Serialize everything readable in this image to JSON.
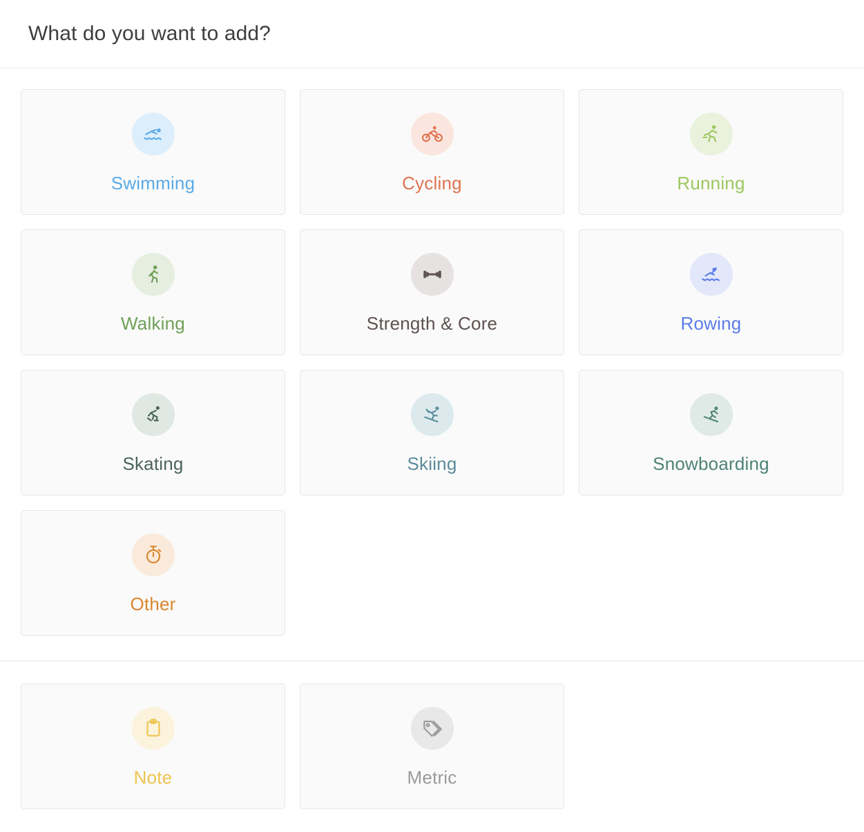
{
  "header": {
    "title": "What do you want to add?"
  },
  "activities": {
    "section_name": "activity-types",
    "items": [
      {
        "id": "swimming",
        "label": "Swimming",
        "icon": "swimmer-icon",
        "color": "#5aaae6",
        "circle_bg": "#dceefb"
      },
      {
        "id": "cycling",
        "label": "Cycling",
        "icon": "cyclist-icon",
        "color": "#df7350",
        "circle_bg": "#fae6de"
      },
      {
        "id": "running",
        "label": "Running",
        "icon": "runner-icon",
        "color": "#9cc75f",
        "circle_bg": "#eaf2dd"
      },
      {
        "id": "walking",
        "label": "Walking",
        "icon": "walker-icon",
        "color": "#6f9f59",
        "circle_bg": "#e6eedf"
      },
      {
        "id": "strength",
        "label": "Strength & Core",
        "icon": "dumbbell-icon",
        "color": "#5d5250",
        "circle_bg": "#e6e2e1"
      },
      {
        "id": "rowing",
        "label": "Rowing",
        "icon": "rower-icon",
        "color": "#5b7ce8",
        "circle_bg": "#e2e7fa"
      },
      {
        "id": "skating",
        "label": "Skating",
        "icon": "skater-icon",
        "color": "#4b6359",
        "circle_bg": "#dfe8e3"
      },
      {
        "id": "skiing",
        "label": "Skiing",
        "icon": "skier-icon",
        "color": "#5b8b9b",
        "circle_bg": "#dceaee"
      },
      {
        "id": "snowboarding",
        "label": "Snowboarding",
        "icon": "snowboarder-icon",
        "color": "#4e8376",
        "circle_bg": "#dfeae6"
      },
      {
        "id": "other",
        "label": "Other",
        "icon": "stopwatch-icon",
        "color": "#d9862f",
        "circle_bg": "#faeadb"
      }
    ]
  },
  "extras": {
    "section_name": "other-entry-types",
    "items": [
      {
        "id": "note",
        "label": "Note",
        "icon": "clipboard-icon",
        "color": "#eec44e",
        "circle_bg": "#fbf3dc"
      },
      {
        "id": "metric",
        "label": "Metric",
        "icon": "tags-icon",
        "color": "#9a9a9a",
        "circle_bg": "#e8e8e8"
      }
    ]
  }
}
